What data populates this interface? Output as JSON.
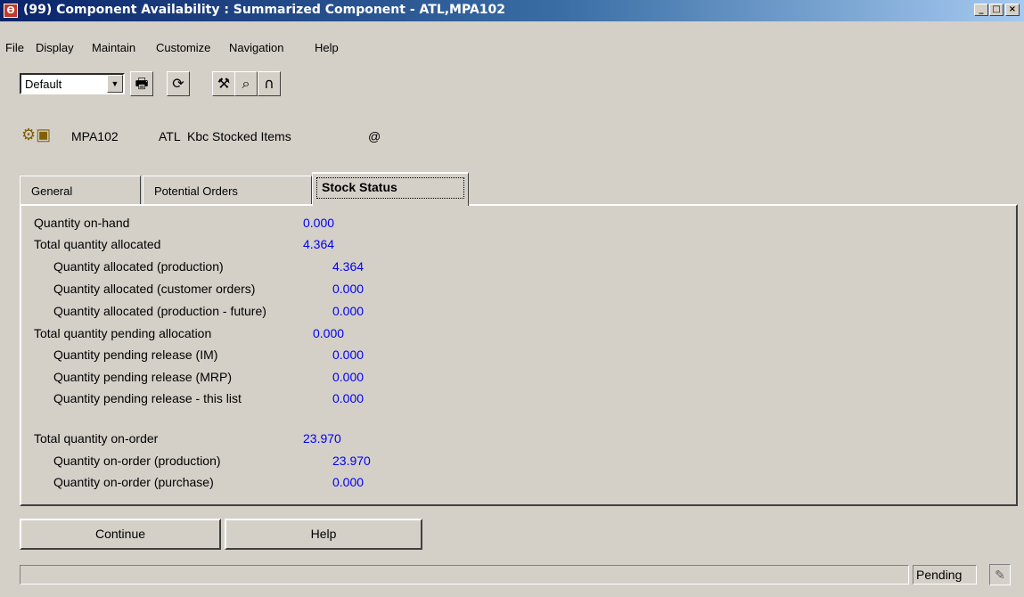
{
  "window": {
    "title": "(99) Component Availability : Summarized Component - ATL,MPA102",
    "app_icon": "ϴ",
    "minimize": "_",
    "maximize": "□",
    "close": "×"
  },
  "menu": [
    "File",
    "Display",
    "Maintain",
    "Customize",
    "Navigation",
    "Help"
  ],
  "toolbar": {
    "view_select": "Default",
    "buttons": [
      "printer-icon",
      "refresh-icon",
      "tools-icon",
      "search-icon",
      "link-icon"
    ]
  },
  "item": {
    "code": "MPA102",
    "warehouse": "ATL",
    "description": "Kbc Stocked Items",
    "symbol": "@"
  },
  "tabs": [
    {
      "label": "General",
      "active": false
    },
    {
      "label": "Potential Orders",
      "active": false
    },
    {
      "label": "Stock Status",
      "active": true
    }
  ],
  "stock_status": [
    {
      "label": "Quantity on-hand",
      "value": "0.000",
      "indent": 0
    },
    {
      "label": "Total quantity allocated",
      "value": "4.364",
      "indent": 0
    },
    {
      "label": "Quantity allocated (production)",
      "value": "4.364",
      "indent": 1
    },
    {
      "label": "Quantity allocated (customer orders)",
      "value": "0.000",
      "indent": 1
    },
    {
      "label": "Quantity allocated (production - future)",
      "value": "0.000",
      "indent": 1
    },
    {
      "label": "Total quantity pending allocation",
      "value": "0.000",
      "indent": 0
    },
    {
      "label": "Quantity pending release (IM)",
      "value": "0.000",
      "indent": 1
    },
    {
      "label": "Quantity pending release (MRP)",
      "value": "0.000",
      "indent": 1
    },
    {
      "label": "Quantity pending release - this list",
      "value": "0.000",
      "indent": 1
    },
    {
      "label": "Total quantity on-order",
      "value": "23.970",
      "indent": 0
    },
    {
      "label": "Quantity on-order (production)",
      "value": "23.970",
      "indent": 1
    },
    {
      "label": "Quantity on-order (purchase)",
      "value": "0.000",
      "indent": 1
    }
  ],
  "buttons": {
    "continue": "Continue",
    "help": "Help"
  },
  "status": {
    "text": "",
    "state": "Pending"
  },
  "colors": {
    "value_text": "#0000ee",
    "titlebar": "#0a246a",
    "background": "#d4d0c8"
  }
}
